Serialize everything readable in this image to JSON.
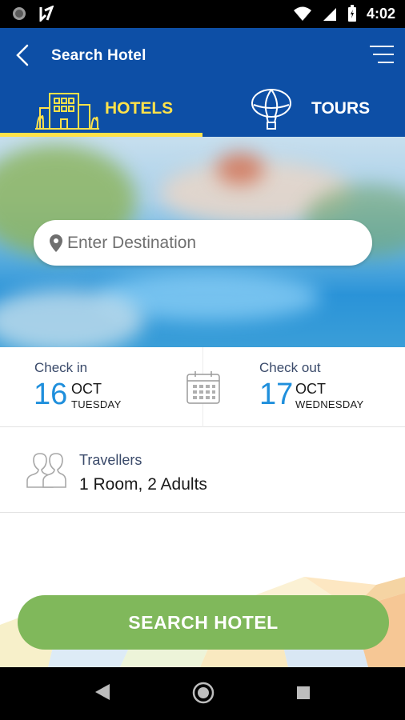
{
  "status_bar": {
    "time": "4:02"
  },
  "app_bar": {
    "title": "Search Hotel"
  },
  "tabs": [
    {
      "label": "HOTELS",
      "active": true
    },
    {
      "label": "TOURS",
      "active": false
    }
  ],
  "search": {
    "placeholder": "Enter Destination"
  },
  "check_in": {
    "caption": "Check in",
    "day": "16",
    "month": "OCT",
    "weekday": "TUESDAY"
  },
  "check_out": {
    "caption": "Check out",
    "day": "17",
    "month": "OCT",
    "weekday": "WEDNESDAY"
  },
  "travellers": {
    "caption": "Travellers",
    "value": "1 Room, 2 Adults"
  },
  "search_button": {
    "label": "SEARCH HOTEL"
  },
  "colors": {
    "primary": "#0d4fa6",
    "accent": "#ffe24a",
    "date_blue": "#1f8fdc",
    "button_green": "#80b85b"
  }
}
